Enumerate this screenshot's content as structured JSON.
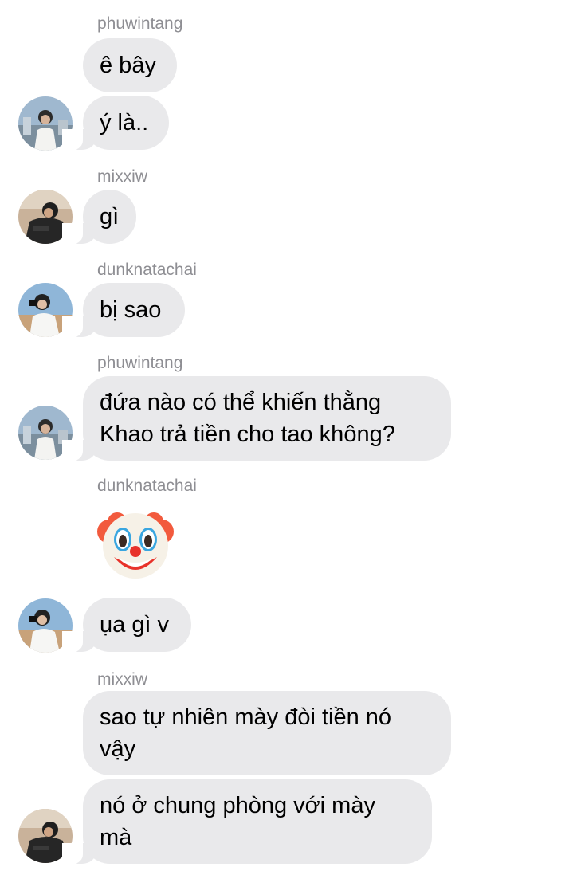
{
  "messages": [
    {
      "sender": "phuwintang",
      "text": "ê bây"
    },
    {
      "text": "ý là.."
    },
    {
      "sender": "mixxiw",
      "text": "gì"
    },
    {
      "sender": "dunknatachai",
      "text": "bị sao"
    },
    {
      "sender": "phuwintang",
      "line1": "đứa nào có thể khiến thằng",
      "line2": "Khao trả tiền cho tao không?"
    },
    {
      "sender": "dunknatachai",
      "emoji": "clown-face"
    },
    {
      "text": "ụa gì v"
    },
    {
      "sender": "mixxiw",
      "line1": "sao tự nhiên mày đòi tiền nó",
      "line2": "vậy"
    },
    {
      "line1": "nó ở chung phòng với mày",
      "line2": "mà"
    }
  ],
  "colors": {
    "bubble": "#e9e9eb",
    "sender_name": "#8e8e93",
    "text": "#000000"
  }
}
